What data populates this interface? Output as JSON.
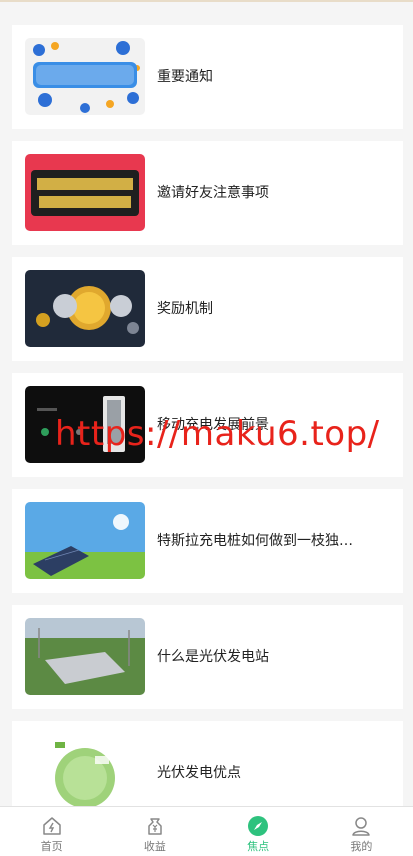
{
  "articles": [
    {
      "title": "重要通知",
      "thumb": "important-notice-banner"
    },
    {
      "title": "邀请好友注意事项",
      "thumb": "invite-friends-banner"
    },
    {
      "title": "奖励机制",
      "thumb": "crypto-coins-banner"
    },
    {
      "title": "移动充电发展前景",
      "thumb": "charging-station-banner"
    },
    {
      "title": "特斯拉充电桩如何做到一枝独…",
      "thumb": "solar-panel-field"
    },
    {
      "title": "什么是光伏发电站",
      "thumb": "power-station-aerial"
    },
    {
      "title": "光伏发电优点",
      "thumb": "green-energy-globe"
    }
  ],
  "watermark": "https://maku6.top/",
  "tabbar": {
    "tabs": [
      {
        "label": "首页",
        "icon": "home-icon"
      },
      {
        "label": "收益",
        "icon": "money-bag-icon"
      },
      {
        "label": "焦点",
        "icon": "compass-icon",
        "active": true
      },
      {
        "label": "我的",
        "icon": "user-icon"
      }
    ]
  },
  "colors": {
    "accent": "#2ec27e",
    "watermark": "#e8231b",
    "background": "#f5f5f5"
  }
}
